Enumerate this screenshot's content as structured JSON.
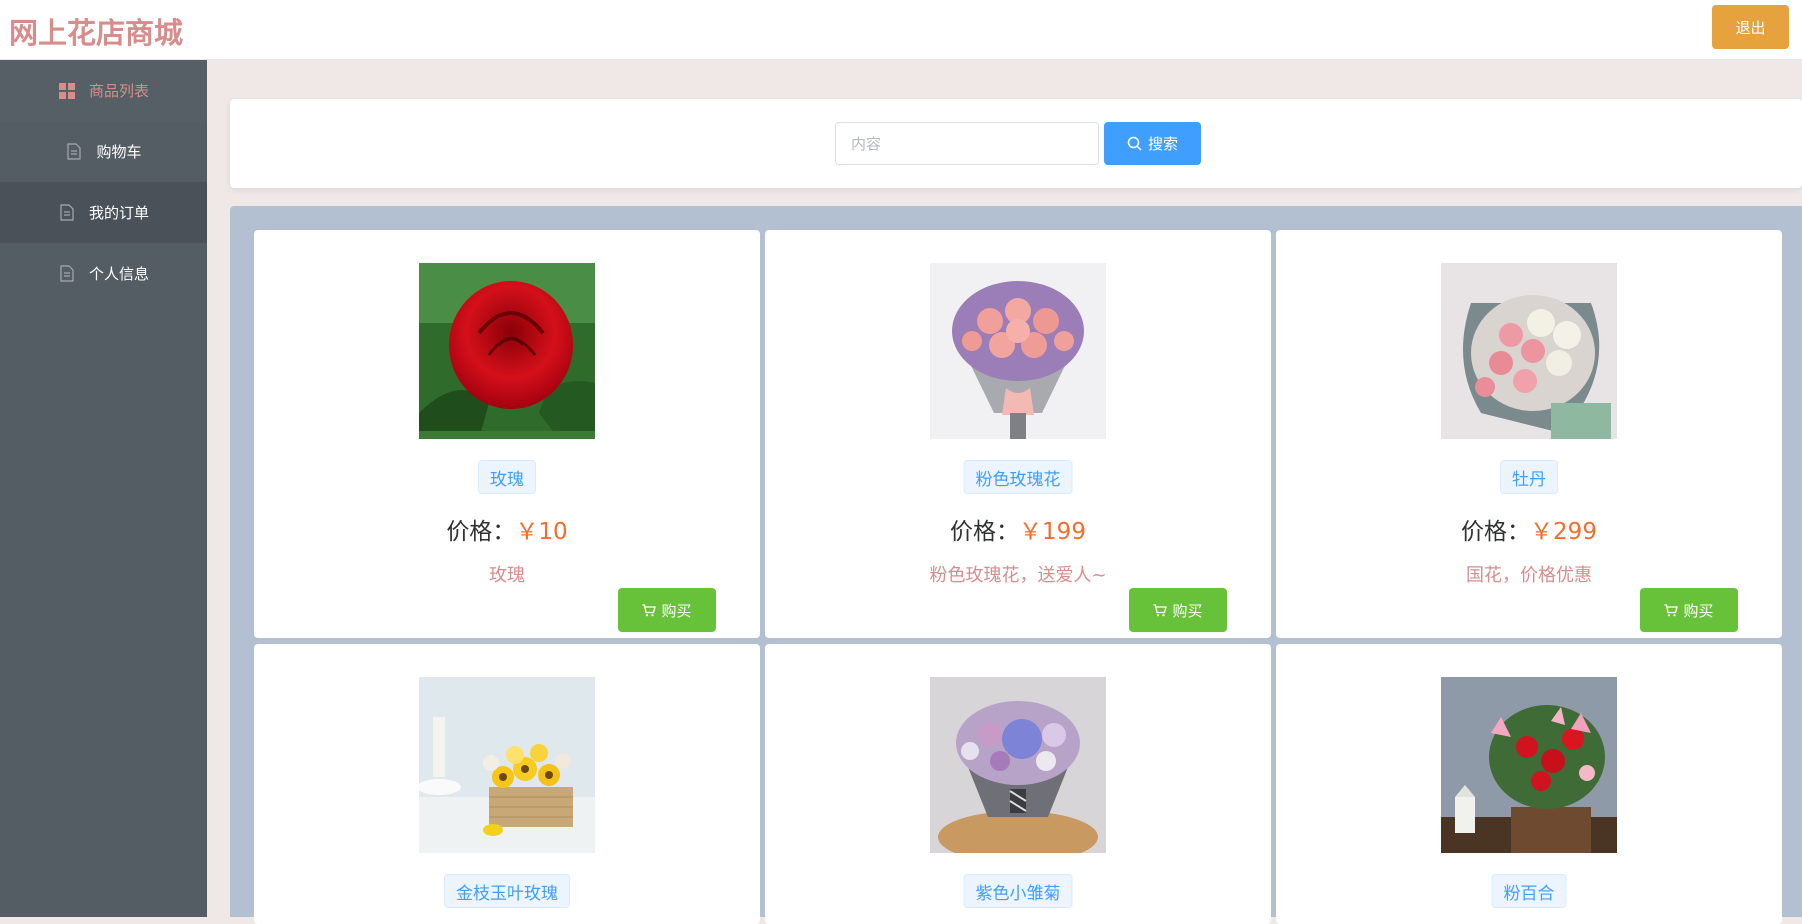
{
  "app": {
    "title": "网上花店商城",
    "logout_label": "退出"
  },
  "sidebar": {
    "items": [
      {
        "label": "商品列表",
        "icon": "grid-icon",
        "active": true
      },
      {
        "label": "购物车",
        "icon": "document-icon"
      },
      {
        "label": "我的订单",
        "icon": "document-icon"
      },
      {
        "label": "个人信息",
        "icon": "document-icon"
      }
    ]
  },
  "search": {
    "placeholder": "内容",
    "value": "",
    "button_label": "搜索"
  },
  "products": {
    "price_label": "价格：",
    "buy_label": "购买",
    "items": [
      {
        "name": "玫瑰",
        "price": "￥10",
        "desc": "玫瑰"
      },
      {
        "name": "粉色玫瑰花",
        "price": "￥199",
        "desc": "粉色玫瑰花，送爱人~"
      },
      {
        "name": "牡丹",
        "price": "￥299",
        "desc": "国花，价格优惠"
      },
      {
        "name": "金枝玉叶玫瑰",
        "price": "",
        "desc": ""
      },
      {
        "name": "紫色小雏菊",
        "price": "",
        "desc": ""
      },
      {
        "name": "粉百合",
        "price": "",
        "desc": ""
      }
    ]
  },
  "colors": {
    "accent_pink": "#d88d8d",
    "warning": "#e6a23c",
    "primary": "#409eff",
    "success": "#67c23a",
    "price": "#f56c2d",
    "sidebar_bg": "#545c64"
  }
}
